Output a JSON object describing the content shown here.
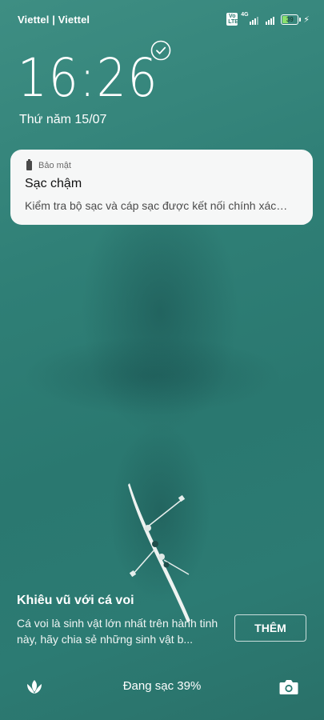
{
  "status_bar": {
    "carrier": "Viettel | Viettel",
    "volte": "Vo LTE",
    "network": "4G",
    "battery_level": "39",
    "battery_fraction": 0.39,
    "battery_color": "#8be06d"
  },
  "lock": {
    "icon": "check-circle-icon"
  },
  "clock": {
    "time": "16:26",
    "date": "Thứ năm 15/07"
  },
  "notification": {
    "app_name": "Bảo mật",
    "title": "Sạc chậm",
    "body": "Kiểm tra bộ sạc và cáp sạc được kết nối chính xác…"
  },
  "story": {
    "title": "Khiêu vũ với cá voi",
    "description": "Cá voi là sinh vật lớn nhất trên hành tinh này, hãy chia sẻ những sinh vật b...",
    "more_label": "THÊM"
  },
  "bottom_bar": {
    "charging_text": "Đang sạc 39%",
    "left_icon": "carousel-flower-icon",
    "right_icon": "camera-icon"
  }
}
